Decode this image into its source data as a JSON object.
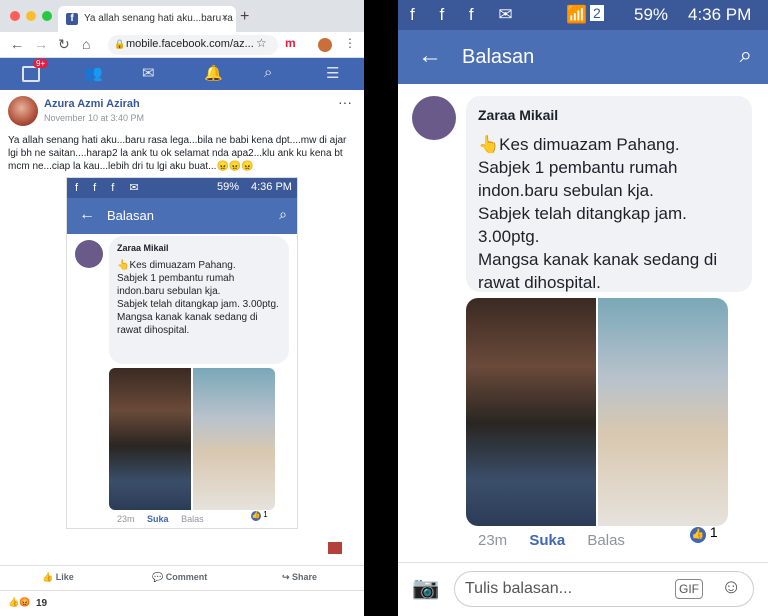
{
  "browser": {
    "tab_title": "Ya allah senang hati aku...baru ra",
    "tab_close": "×",
    "new_tab": "+",
    "url": "mobile.facebook.com/az...",
    "extension_label": "m"
  },
  "fb_nav": {
    "badge": "9+"
  },
  "post": {
    "author": "Azura Azmi Azirah",
    "date": "November 10 at 3:40 PM",
    "text": "Ya allah senang hati aku...baru rasa lega...bila ne babi kena dpt....mw di ajar lgi bh ne saitan....harap2 la ank tu ok selamat nda apa2...klu ank ku kena bt mcm ne...ciap la kau...lebih dri tu lgi aku buat...😠😠😠",
    "more": "···",
    "like": "Like",
    "comment": "Comment",
    "share": "Share",
    "reaction_count": "19"
  },
  "screenshot": {
    "battery": "59%",
    "time": "4:36 PM",
    "title": "Balasan",
    "commenter": "Zaraa Mikail",
    "lines": [
      "👆Kes dimuazam Pahang.",
      "Sabjek 1 pembantu rumah indon.baru sebulan kja.",
      "Sabjek telah ditangkap jam. 3.00ptg.",
      "Mangsa kanak kanak sedang di rawat dihospital."
    ],
    "time_ago": "23m",
    "suka": "Suka",
    "balas": "Balas",
    "like_count": "1",
    "reply_placeholder": "Tulis balasan...",
    "gif": "GIF",
    "sim": "2"
  },
  "colors": {
    "fb_blue": "#4267b2",
    "status_blue": "#3b5998"
  }
}
